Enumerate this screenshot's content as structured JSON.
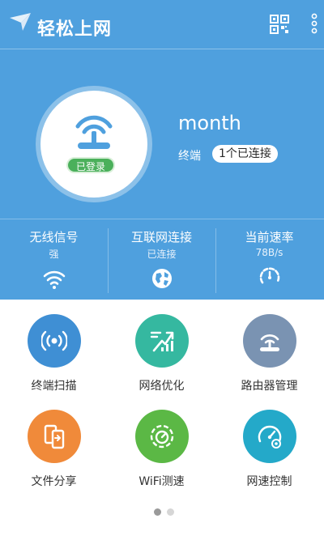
{
  "app": {
    "title": "轻松上网"
  },
  "header": {
    "qr_icon": "qr-code-icon",
    "more_icon": "more-vert-icon"
  },
  "router": {
    "status_badge": "已登录",
    "network_name": "month",
    "terminal_label": "终端",
    "terminal_count": "1个已连接"
  },
  "stats": [
    {
      "label": "无线信号",
      "value": "强",
      "icon": "wifi-icon"
    },
    {
      "label": "互联网连接",
      "value": "已连接",
      "icon": "globe-icon"
    },
    {
      "label": "当前速率",
      "value": "78B/s",
      "icon": "speed-gauge-icon"
    }
  ],
  "tools": [
    {
      "label": "终端扫描",
      "icon": "scan-icon",
      "color": "#3f8fd4"
    },
    {
      "label": "网络优化",
      "icon": "optimize-icon",
      "color": "#35b8a0"
    },
    {
      "label": "路由器管理",
      "icon": "router-icon",
      "color": "#7a93b2"
    },
    {
      "label": "文件分享",
      "icon": "file-share-icon",
      "color": "#f08a3a"
    },
    {
      "label": "WiFi测速",
      "icon": "speedtest-icon",
      "color": "#5bb845"
    },
    {
      "label": "网速控制",
      "icon": "speed-control-icon",
      "color": "#24a9c9"
    }
  ],
  "pager": {
    "active": 1,
    "total": 2
  },
  "colors": {
    "primary": "#4fa0de",
    "badge": "#4bb05b"
  }
}
